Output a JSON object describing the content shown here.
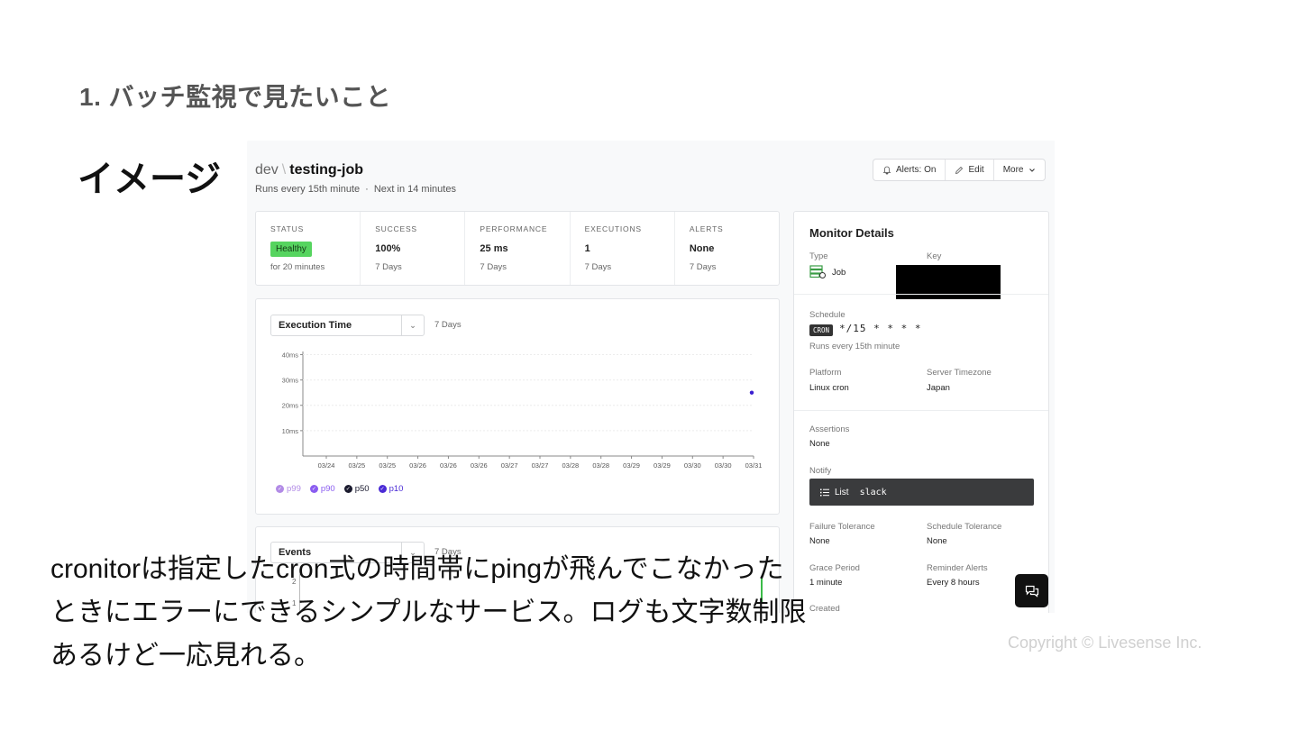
{
  "slide": {
    "heading": "1. バッチ監視で見たいこと",
    "label": "イメージ",
    "caption": "cronitorは指定したcron式の時間帯にpingが飛んでこなかったときにエラーにできるシンプルなサービス。ログも文字数制限あるけど一応見れる。",
    "copyright": "Copyright © Livesense Inc."
  },
  "app": {
    "env": "dev",
    "separator": "\\",
    "job_name": "testing-job",
    "schedule_text": "Runs every 15th minute",
    "dot": "·",
    "next_run": "Next in 14 minutes",
    "buttons": {
      "alerts": "Alerts: On",
      "edit": "Edit",
      "more": "More"
    },
    "stats": {
      "status": {
        "label": "STATUS",
        "value": "Healthy",
        "sub": "for 20 minutes"
      },
      "success": {
        "label": "SUCCESS",
        "value": "100%",
        "sub": "7 Days"
      },
      "performance": {
        "label": "PERFORMANCE",
        "value": "25 ms",
        "sub": "7 Days"
      },
      "executions": {
        "label": "EXECUTIONS",
        "value": "1",
        "sub": "7 Days"
      },
      "alerts": {
        "label": "ALERTS",
        "value": "None",
        "sub": "7 Days"
      }
    },
    "chart": {
      "selector": "Execution Time",
      "range": "7 Days"
    },
    "events": {
      "selector": "Events",
      "range": "7 Days",
      "ticks": [
        "2",
        "1"
      ]
    },
    "details": {
      "title": "Monitor Details",
      "type_label": "Type",
      "type_value": "Job",
      "key_label": "Key",
      "schedule_label": "Schedule",
      "cron_badge": "CRON",
      "cron_expr": "*/15 * * * *",
      "schedule_desc": "Runs every 15th minute",
      "platform_label": "Platform",
      "platform_value": "Linux cron",
      "timezone_label": "Server Timezone",
      "timezone_value": "Japan",
      "assertions_label": "Assertions",
      "assertions_value": "None",
      "notify_label": "Notify",
      "notify_list": "List",
      "notify_value": "slack",
      "failure_label": "Failure Tolerance",
      "failure_value": "None",
      "sched_tol_label": "Schedule Tolerance",
      "sched_tol_value": "None",
      "grace_label": "Grace Period",
      "grace_value": "1 minute",
      "reminder_label": "Reminder Alerts",
      "reminder_value": "Every 8 hours",
      "created_label": "Created"
    }
  },
  "colors": {
    "healthy": "#56d45f",
    "p99": "#b28be6",
    "p90": "#8a5cf0",
    "p50": "#1a1a2e",
    "p10": "#4a2bd6"
  },
  "chart_data": {
    "type": "scatter",
    "title": "Execution Time",
    "y_unit": "ms",
    "yticks": [
      "10ms",
      "20ms",
      "30ms",
      "40ms"
    ],
    "yvalues": [
      10,
      20,
      30,
      40
    ],
    "ylim": [
      0,
      40
    ],
    "categories": [
      "03/24",
      "03/25",
      "03/25",
      "03/26",
      "03/26",
      "03/26",
      "03/27",
      "03/27",
      "03/28",
      "03/28",
      "03/29",
      "03/29",
      "03/30",
      "03/30",
      "03/31"
    ],
    "series": [
      {
        "name": "p99",
        "values": []
      },
      {
        "name": "p90",
        "values": []
      },
      {
        "name": "p50",
        "values": []
      },
      {
        "name": "p10",
        "values": []
      }
    ],
    "points": [
      {
        "category_index": 14.6,
        "value": 25
      }
    ],
    "legend": [
      {
        "name": "p99",
        "color": "#b28be6"
      },
      {
        "name": "p90",
        "color": "#8a5cf0"
      },
      {
        "name": "p50",
        "color": "#1a1a2e"
      },
      {
        "name": "p10",
        "color": "#4a2bd6"
      }
    ],
    "grid": true
  }
}
